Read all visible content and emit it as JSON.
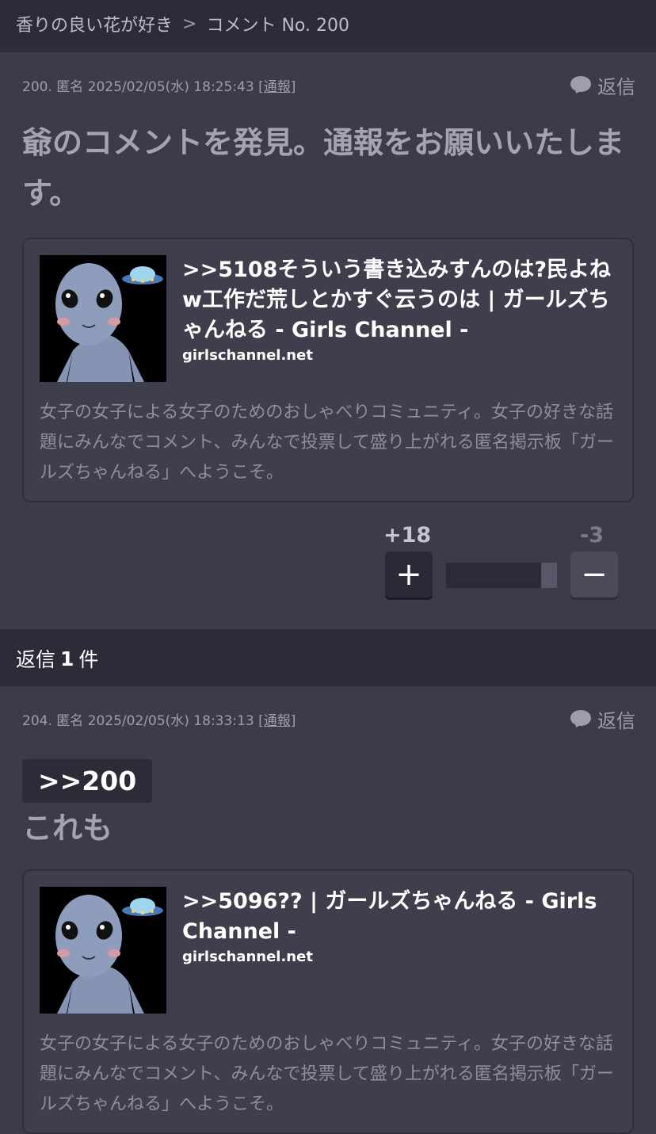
{
  "breadcrumb": {
    "topic": "香りの良い花が好き",
    "separator": ">",
    "current": "コメント No. 200"
  },
  "post1": {
    "meta": "200. 匿名 2025/02/05(水) 18:25:43",
    "report_label": "[通報]",
    "reply_label": "返信",
    "body": "爺のコメントを発見。通報をお願いいたします。",
    "card": {
      "title": ">>5108そういう書き込みすんのは?民よねw工作だ荒しとかすぐ云うのは | ガールズちゃんねる - Girls Channel -",
      "domain": "girlschannel.net",
      "description": "女子の女子による女子のためのおしゃべりコミュニティ。女子の好きな話題にみんなでコメント、みんなで投票して盛り上がれる匿名掲示板「ガールズちゃんねる」へようこそ。"
    },
    "votes": {
      "plus": "+18",
      "minus": "-3",
      "plus_symbol": "+",
      "minus_symbol": "−",
      "minus_ratio": 0.14
    }
  },
  "replies": {
    "prefix": "返信",
    "count": "1",
    "suffix": "件"
  },
  "post2": {
    "meta": "204. 匿名 2025/02/05(水) 18:33:13",
    "report_label": "[通報]",
    "reply_label": "返信",
    "anchor": ">>200",
    "body": "これも",
    "card": {
      "title": ">>5096?? | ガールズちゃんねる - Girls Channel -",
      "domain": "girlschannel.net",
      "description": "女子の女子による女子のためのおしゃべりコミュニティ。女子の好きな話題にみんなでコメント、みんなで投票して盛り上がれる匿名掲示板「ガールズちゃんねる」へようこそ。"
    }
  },
  "icons": {
    "reply": "speech-bubble-icon",
    "thumbnail": "alien-ufo-illustration"
  },
  "colors": {
    "background": "#3c3b4a",
    "header": "#2c2b38",
    "card": "#3f3e4d",
    "text_muted": "#a9a8b6"
  }
}
